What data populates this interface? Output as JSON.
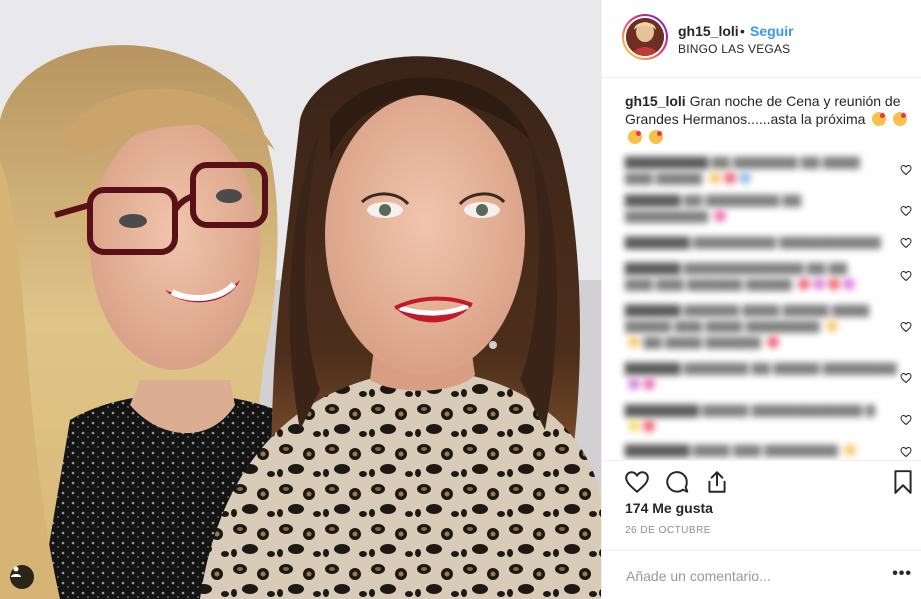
{
  "post": {
    "username": "gh15_loli",
    "separator": "•",
    "follow_label": "Seguir",
    "location": "BINGO LAS VEGAS",
    "caption": {
      "username": "gh15_loli",
      "text": "Gran noche de Cena y reunión de Grandes Hermanos......asta la próxima"
    },
    "likes": "174 Me gusta",
    "date": "26 DE OCTUBRE",
    "comment_placeholder": "Añade un comentario...",
    "more_label": "•••"
  },
  "colors": {
    "link_blue": "#3897f0",
    "text_dark": "#262626",
    "text_gray": "#8e8e8e",
    "border": "#efefef"
  },
  "icons": [
    "user-tag-icon",
    "heart-icon",
    "comment-icon",
    "share-icon",
    "bookmark-icon",
    "more-options-icon"
  ]
}
